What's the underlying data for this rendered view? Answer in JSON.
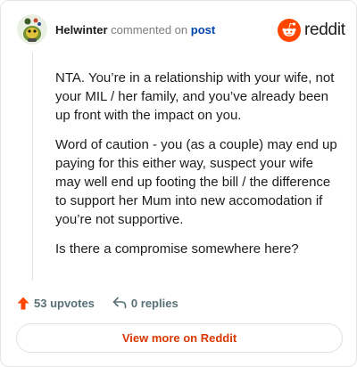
{
  "header": {
    "author": "Helwinter",
    "commented_text": "commented on",
    "post_link": "post"
  },
  "brand": {
    "name": "reddit",
    "accent_color": "#ff4500"
  },
  "comment": {
    "paragraphs": [
      "NTA. You’re in a relationship with your wife, not your MIL / her family, and you’ve already been up front with the impact on you.",
      "Word of caution - you (as a couple) may end up paying for this either way, suspect your wife may well end up footing the bill / the difference to support her Mum into new accomodation if you’re not supportive.",
      "Is there a compromise somewhere here?"
    ]
  },
  "actions": {
    "upvotes": "53 upvotes",
    "replies": "0 replies",
    "upvote_color": "#ff4500"
  },
  "footer": {
    "view_more": "View more on Reddit"
  }
}
